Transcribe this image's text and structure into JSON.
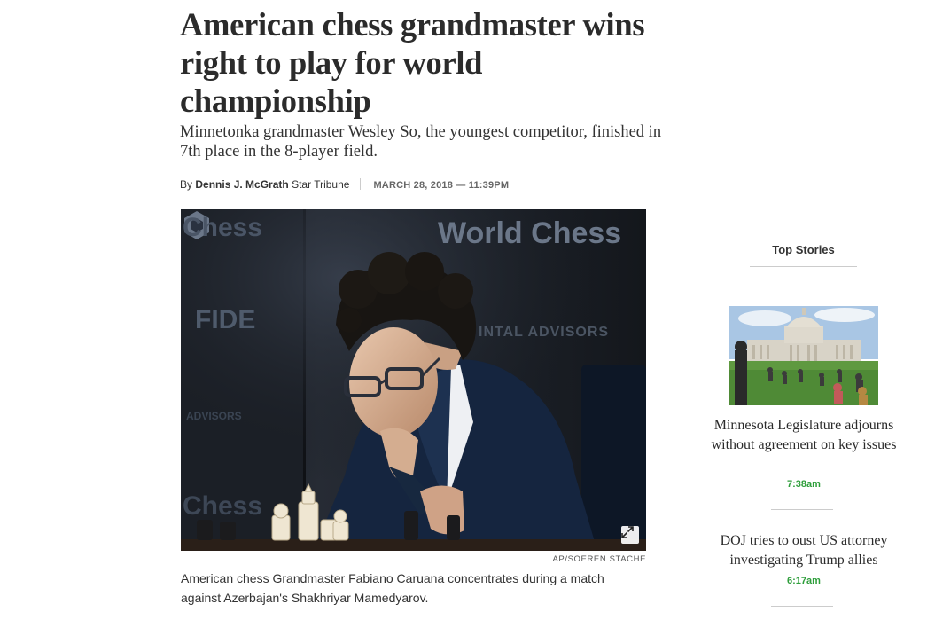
{
  "article": {
    "headline": "American chess grandmaster wins right to play for world championship",
    "deck": "Minnetonka grandmaster Wesley So, the youngest competitor, finished in 7th place in the 8-player field.",
    "byline": {
      "prefix": "By",
      "author": "Dennis J. McGrath",
      "outlet": "Star Tribune",
      "datetime": "MARCH 28, 2018 — 11:39PM"
    },
    "photo": {
      "credit": "AP/SOEREN STACHE",
      "caption": "American chess Grandmaster Fabiano Caruana concentrates during a match against Azerbajan's Shakhriyar Mamedyarov.",
      "background_text": {
        "chess_top": "Chess",
        "fide": "FIDE",
        "chess_bottom": "Chess",
        "world_chess": "World Chess",
        "sponsor": "INTAL ADVISORS",
        "sponsor_left": "ADVISORS"
      }
    }
  },
  "sidebar": {
    "title": "Top Stories",
    "stories": [
      {
        "title": "Minnesota Legislature adjourns without agreement on key issues",
        "time": "7:38am"
      },
      {
        "title": "DOJ tries to oust US attorney investigating Trump allies",
        "time": "6:17am"
      }
    ]
  },
  "colors": {
    "time_green": "#2e9e3b",
    "headline": "#2b2b2b",
    "rule": "#cccccc"
  },
  "icons": {
    "expand": "expand-icon"
  }
}
